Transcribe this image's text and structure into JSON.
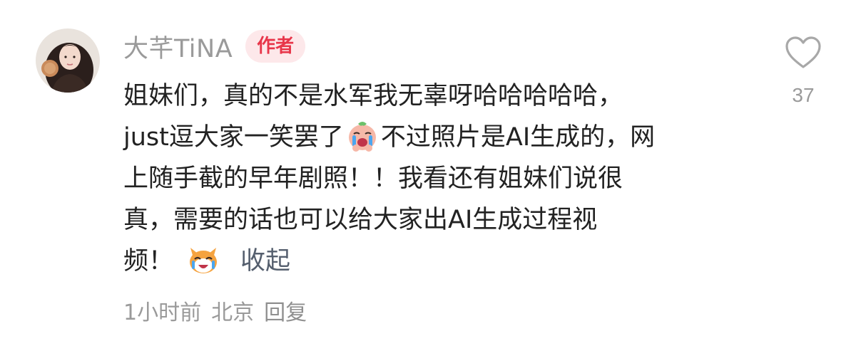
{
  "comment": {
    "username": "大芊TiNA",
    "badge": "作者",
    "lines": [
      "姐妹们，真的不是水军我无辜呀哈哈哈哈哈，",
      "just逗大家一笑罢了",
      "不过照片是AI生成的，网",
      "上随手截的早年剧照！！我看还有姐妹们说很",
      "真，需要的话也可以给大家出AI生成过程视",
      "频！"
    ],
    "emojis": [
      "crying-face-emoji",
      "laughing-cat-emoji"
    ],
    "collapse_label": "收起",
    "time": "1小时前",
    "location": "北京",
    "reply_label": "回复",
    "like_count": "37"
  },
  "icons": {
    "like": "heart-outline-icon"
  },
  "colors": {
    "badge_bg": "#fde8ea",
    "badge_text": "#e8364a",
    "meta_text": "#9a9a9a",
    "body_text": "#222222"
  }
}
